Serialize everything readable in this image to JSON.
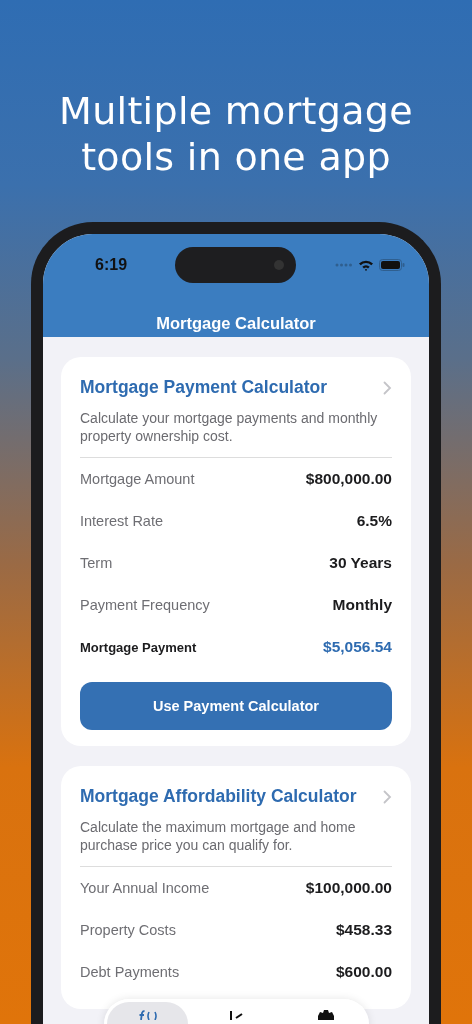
{
  "headline": "Multiple mortgage tools in one app",
  "status_bar": {
    "time": "6:19"
  },
  "nav": {
    "title": "Mortgage Calculator"
  },
  "cards": [
    {
      "title": "Mortgage Payment Calculator",
      "description": "Calculate your mortgage payments and monthly property ownership cost.",
      "rows": [
        {
          "kind": "plain",
          "label": "Mortgage Amount",
          "value": "$800,000.00"
        },
        {
          "kind": "plain",
          "label": "Interest Rate",
          "value": "6.5%"
        },
        {
          "kind": "plain",
          "label": "Term",
          "value": "30 Years"
        },
        {
          "kind": "plain",
          "label": "Payment Frequency",
          "value": "Monthly"
        },
        {
          "kind": "result",
          "label": "Mortgage Payment",
          "value": "$5,056.54"
        }
      ],
      "button": "Use Payment Calculator"
    },
    {
      "title": "Mortgage Affordability Calculator",
      "description": "Calculate the maximum mortgage and home purchase price you can qualify for.",
      "rows": [
        {
          "kind": "plain",
          "label": "Your Annual Income",
          "value": "$100,000.00"
        },
        {
          "kind": "plain",
          "label": "Property Costs",
          "value": "$458.33"
        },
        {
          "kind": "plain",
          "label": "Debt Payments",
          "value": "$600.00"
        }
      ]
    }
  ],
  "tab_bar": {
    "tabs": [
      {
        "selected": true
      },
      {
        "selected": false
      },
      {
        "selected": false
      }
    ]
  }
}
